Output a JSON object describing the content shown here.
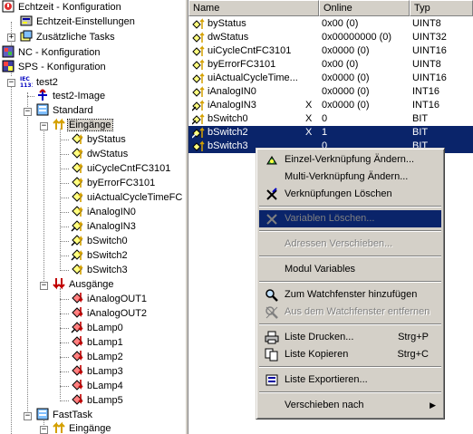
{
  "tree": {
    "echtzeit": "Echtzeit - Konfiguration",
    "echtzeit_einst": "Echtzeit-Einstellungen",
    "zusatz_tasks": "Zusätzliche Tasks",
    "nc": "NC - Konfiguration",
    "sps": "SPS - Konfiguration",
    "test2": "test2",
    "test2_image": "test2-Image",
    "standard": "Standard",
    "eingaenge": "Eingänge",
    "inputs": [
      "byStatus",
      "dwStatus",
      "uiCycleCntFC3101",
      "byErrorFC3101",
      "uiActualCycleTimeFC",
      "iAnalogIN0",
      "iAnalogIN3",
      "bSwitch0",
      "bSwitch2",
      "bSwitch3"
    ],
    "ausgaenge": "Ausgänge",
    "outputs": [
      "iAnalogOUT1",
      "iAnalogOUT2",
      "bLamp0",
      "bLamp1",
      "bLamp2",
      "bLamp3",
      "bLamp4",
      "bLamp5"
    ],
    "fasttask": "FastTask",
    "fast_eingaenge": "Eingänge",
    "iec_badge": "IEC 1131"
  },
  "list": {
    "headers": {
      "name": "Name",
      "online": "Online",
      "typ": "Typ"
    },
    "rows": [
      {
        "name": "byStatus",
        "x": "",
        "online": "0x00 (0)",
        "typ": "UINT8"
      },
      {
        "name": "dwStatus",
        "x": "",
        "online": "0x00000000 (0)",
        "typ": "UINT32"
      },
      {
        "name": "uiCycleCntFC3101",
        "x": "",
        "online": "0x0000 (0)",
        "typ": "UINT16"
      },
      {
        "name": "byErrorFC3101",
        "x": "",
        "online": "0x00 (0)",
        "typ": "UINT8"
      },
      {
        "name": "uiActualCycleTime...",
        "x": "",
        "online": "0x0000 (0)",
        "typ": "UINT16"
      },
      {
        "name": "iAnalogIN0",
        "x": "",
        "online": "0x0000 (0)",
        "typ": "INT16"
      },
      {
        "name": "iAnalogIN3",
        "x": "X",
        "online": "0x0000 (0)",
        "typ": "INT16"
      },
      {
        "name": "bSwitch0",
        "x": "X",
        "online": "0",
        "typ": "BIT"
      },
      {
        "name": "bSwitch2",
        "x": "X",
        "online": "1",
        "typ": "BIT"
      },
      {
        "name": "bSwitch3",
        "x": "",
        "online": "0",
        "typ": "BIT"
      }
    ]
  },
  "menu": {
    "einzel": "Einzel-Verknüpfung Ändern...",
    "multi": "Multi-Verknüpfung Ändern...",
    "verk_loeschen": "Verknüpfungen Löschen",
    "var_loeschen": "Variablen Löschen...",
    "adressen": "Adressen Verschieben...",
    "modul": "Modul Variables",
    "watch_add": "Zum Watchfenster hinzufügen",
    "watch_remove": "Aus dem Watchfenster entfernen",
    "drucken": "Liste Drucken...",
    "drucken_sc": "Strg+P",
    "kopieren": "Liste Kopieren",
    "kopieren_sc": "Strg+C",
    "exportieren": "Liste Exportieren...",
    "verschieben": "Verschieben nach"
  },
  "colors": {
    "selection": "#0a246a",
    "input_arrow": "#d4a000",
    "output_arrow": "#c00000",
    "window_bg": "#d4d0c8"
  }
}
